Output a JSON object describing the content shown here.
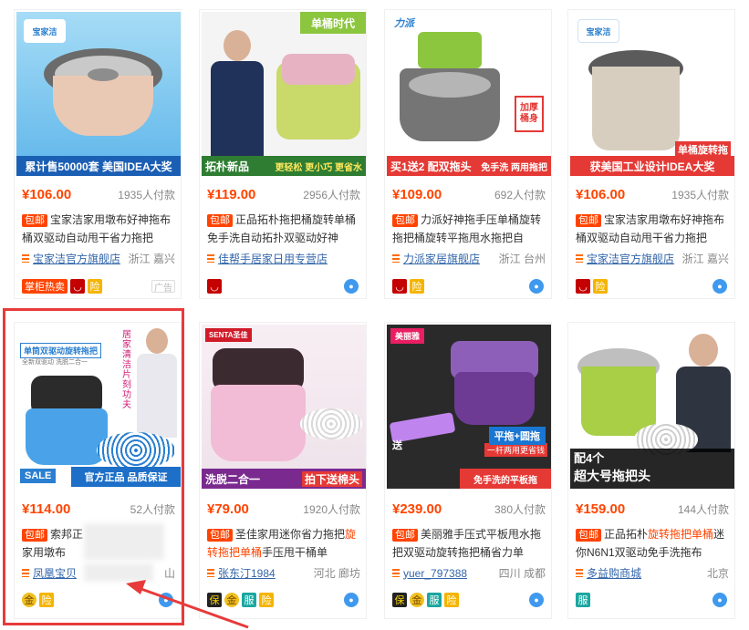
{
  "products": [
    {
      "price": "¥106.00",
      "sales": "1935人付款",
      "baoyou": "包邮",
      "title": "宝家洁家用墩布好神拖布桶双驱动自动甩干省力拖把",
      "shop": "宝家洁官方旗舰店",
      "location": "浙江 嘉兴",
      "banner": "累计售50000套 美国IDEA大奖",
      "logo": "宝家洁",
      "badges": [
        "掌柜热卖",
        "天猫",
        "险"
      ],
      "ad": "广告"
    },
    {
      "price": "¥119.00",
      "sales": "2956人付款",
      "baoyou": "包邮",
      "title": "正品拓朴拖把桶旋转单桶免手洗自动拓扑双驱动好神",
      "shop": "佳帮手居家日用专营店",
      "location": "",
      "banner": "拓朴新品",
      "banner2": "更轻松 更小巧 更省水",
      "corner": "单桶时代",
      "badges": [
        "天猫"
      ]
    },
    {
      "price": "¥109.00",
      "sales": "692人付款",
      "baoyou": "包邮",
      "title": "力派好神拖手压单桶旋转拖把桶旋转平拖甩水拖把自",
      "shop": "力派家居旗舰店",
      "location": "浙江 台州",
      "banner": "买1送2 配双拖头",
      "banner2": "免手洗 两用拖把",
      "tag": "加厚桶身",
      "logo": "力派",
      "badges": [
        "天猫",
        "险"
      ]
    },
    {
      "price": "¥106.00",
      "sales": "1935人付款",
      "baoyou": "包邮",
      "title": "宝家洁家用墩布好神拖布桶双驱动自动甩干省力拖把",
      "shop": "宝家洁官方旗舰店",
      "location": "浙江 嘉兴",
      "banner": "获美国工业设计IDEA大奖",
      "tag": "单桶旋转拖",
      "logo": "宝家洁",
      "badges": [
        "天猫",
        "险"
      ]
    },
    {
      "price": "¥114.00",
      "sales": "52人付款",
      "baoyou": "包邮",
      "title_prefix": "索邦正",
      "title_line2": "家用墩布",
      "shop": "凤凰宝贝",
      "location_end": "山",
      "banner": "官方正品 品质保证",
      "headline": "单筒双驱动旋转拖把",
      "sub": "全新双驱动 洗脱二合一",
      "vertical": "居家清洁 片刻功夫",
      "sale": "SALE",
      "badges": [
        "金",
        "险"
      ]
    },
    {
      "price": "¥79.00",
      "sales": "1920人付款",
      "baoyou": "包邮",
      "title_a": "圣佳家用迷你省力拖把",
      "title_hl": "旋转拖把单桶",
      "title_b": "手压甩干桶单",
      "shop": "张东汀1984",
      "location": "河北 廊坊",
      "banner": "洗脱二合一",
      "banner2": "拍下送棉头",
      "logo": "SENTA圣佳",
      "badges": [
        "保",
        "金",
        "服",
        "险"
      ]
    },
    {
      "price": "¥239.00",
      "sales": "380人付款",
      "baoyou": "包邮",
      "title": "美丽雅手压式平板甩水拖把双驱动旋转拖把桶省力单",
      "shop": "yuer_797388",
      "location": "四川 成都",
      "banner": "平拖+圆拖",
      "banner2": "免手洗的平板拖",
      "tag": "一杆两用更省钱",
      "logo": "美丽雅",
      "send": "送",
      "badges": [
        "保",
        "金",
        "服",
        "险"
      ]
    },
    {
      "price": "¥159.00",
      "sales": "144人付款",
      "baoyou": "包邮",
      "title_a": "正品拓朴",
      "title_hl": "旋转拖把单桶",
      "title_b": "迷你N6N1双驱动免手洗拖布",
      "shop": "多益购商城",
      "location": "北京",
      "banner": "配4个",
      "banner2": "超大号拖把头",
      "badges": [
        "服"
      ]
    }
  ],
  "colors": {
    "price": "#ff4400",
    "highlight": "#e83a3a",
    "link": "#3366aa",
    "wangwang": "#3f99ee"
  }
}
